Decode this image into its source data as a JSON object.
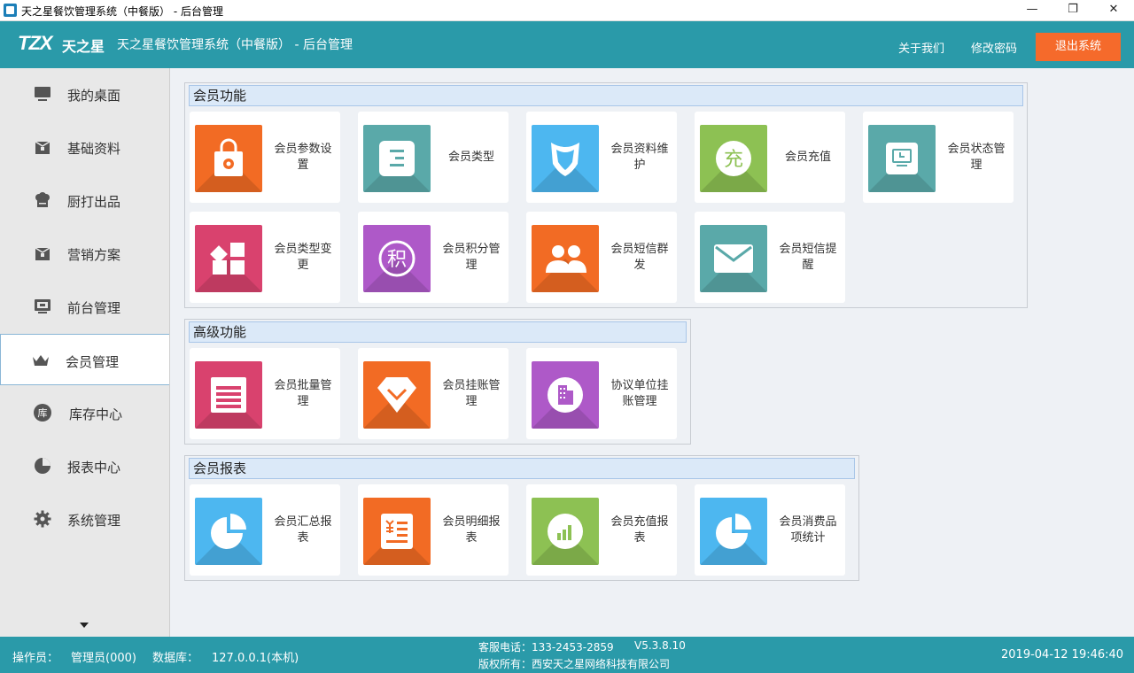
{
  "window": {
    "title": "天之星餐饮管理系统（中餐版） - 后台管理",
    "minimize": "—",
    "maximize": "❐",
    "close": "✕"
  },
  "header": {
    "logo_mark": "TZX",
    "logo_brand": "天之星",
    "title": "天之星餐饮管理系统（中餐版） - 后台管理",
    "about": "关于我们",
    "change_password": "修改密码",
    "logout": "退出系统",
    "colors": {
      "bar": "#2a9aa9",
      "logout": "#f56a2b"
    }
  },
  "sidebar": {
    "items": [
      {
        "label": "我的桌面",
        "icon": "monitor-icon"
      },
      {
        "label": "基础资料",
        "icon": "box-icon"
      },
      {
        "label": "厨打出品",
        "icon": "chef-hat-icon"
      },
      {
        "label": "营销方案",
        "icon": "box-icon"
      },
      {
        "label": "前台管理",
        "icon": "screen-icon"
      },
      {
        "label": "会员管理",
        "icon": "crown-icon",
        "active": true
      },
      {
        "label": "库存中心",
        "icon": "warehouse-icon",
        "glyph": "库"
      },
      {
        "label": "报表中心",
        "icon": "pie-icon"
      },
      {
        "label": "系统管理",
        "icon": "gear-icon"
      }
    ]
  },
  "sections": {
    "member_functions": {
      "title": "会员功能",
      "tiles": [
        {
          "label": "会员参数设置",
          "color": "#f26b24",
          "icon": "bag-gear-icon"
        },
        {
          "label": "会员类型",
          "color": "#5aa9a9",
          "icon": "list-card-icon"
        },
        {
          "label": "会员资料维护",
          "color": "#4db7f0",
          "icon": "shield-icon"
        },
        {
          "label": "会员充值",
          "color": "#8dc153",
          "icon": "recharge-icon",
          "glyph": "充"
        },
        {
          "label": "会员状态管理",
          "color": "#5aa9a9",
          "icon": "monitor-status-icon"
        },
        {
          "label": "会员类型变更",
          "color": "#d9426e",
          "icon": "blocks-icon"
        },
        {
          "label": "会员积分管理",
          "color": "#ae59c8",
          "icon": "points-icon",
          "glyph": "积"
        },
        {
          "label": "会员短信群发",
          "color": "#f26b24",
          "icon": "group-icon"
        },
        {
          "label": "会员短信提醒",
          "color": "#5aa9a9",
          "icon": "mail-icon"
        }
      ]
    },
    "advanced_functions": {
      "title": "高级功能",
      "tiles": [
        {
          "label": "会员批量管理",
          "color": "#d9426e",
          "icon": "batch-icon"
        },
        {
          "label": "会员挂账管理",
          "color": "#f26b24",
          "icon": "gem-icon"
        },
        {
          "label": "协议单位挂账管理",
          "color": "#ae59c8",
          "icon": "building-icon"
        }
      ]
    },
    "member_reports": {
      "title": "会员报表",
      "tiles": [
        {
          "label": "会员汇总报表",
          "color": "#4db7f0",
          "icon": "pie-chart-icon"
        },
        {
          "label": "会员明细报表",
          "color": "#f26b24",
          "icon": "receipt-icon"
        },
        {
          "label": "会员充值报表",
          "color": "#8dc153",
          "icon": "bar-chart-icon"
        },
        {
          "label": "会员消费品项统计",
          "color": "#4db7f0",
          "icon": "pie-chart-icon"
        }
      ]
    }
  },
  "status": {
    "operator_label": "操作员：",
    "operator_value": "管理员(000)",
    "db_label": "数据库：",
    "db_value": "127.0.0.1(本机)",
    "hotline": "客服电话：133-2453-2859",
    "version": "V5.3.8.10",
    "copyright": "版权所有：西安天之星网络科技有限公司",
    "datetime": "2019-04-12 19:46:40"
  }
}
